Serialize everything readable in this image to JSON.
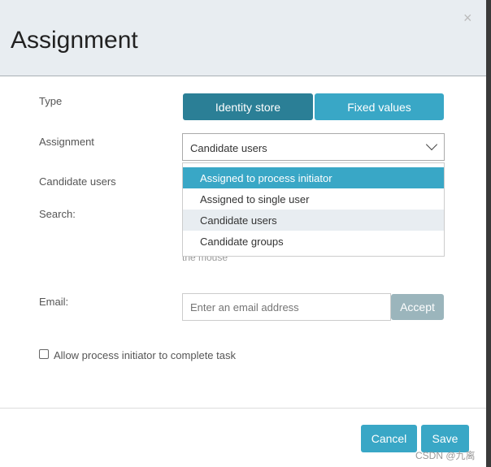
{
  "dialog": {
    "title": "Assignment",
    "close": "×"
  },
  "form": {
    "type_label": "Type",
    "type_options": [
      "Identity store",
      "Fixed values"
    ],
    "type_selected": "Identity store",
    "assignment_label": "Assignment",
    "assignment_value": "Candidate users",
    "assignment_options": [
      "Assigned to process initiator",
      "Assigned to single user",
      "Candidate users",
      "Candidate groups"
    ],
    "candidate_users_label": "Candidate users",
    "search_label": "Search:",
    "hint_fragment": "the mouse",
    "email_label": "Email:",
    "email_placeholder": "Enter an email address",
    "accept_label": "Accept",
    "checkbox_label": "Allow process initiator to complete task",
    "checkbox_checked": false
  },
  "footer": {
    "cancel": "Cancel",
    "save": "Save"
  },
  "watermark": "CSDN @九离",
  "colors": {
    "primary": "#39a7c6",
    "primary_dark": "#2b7f96",
    "disabled": "#9bb5bc",
    "header_bg": "#e8edf1"
  }
}
